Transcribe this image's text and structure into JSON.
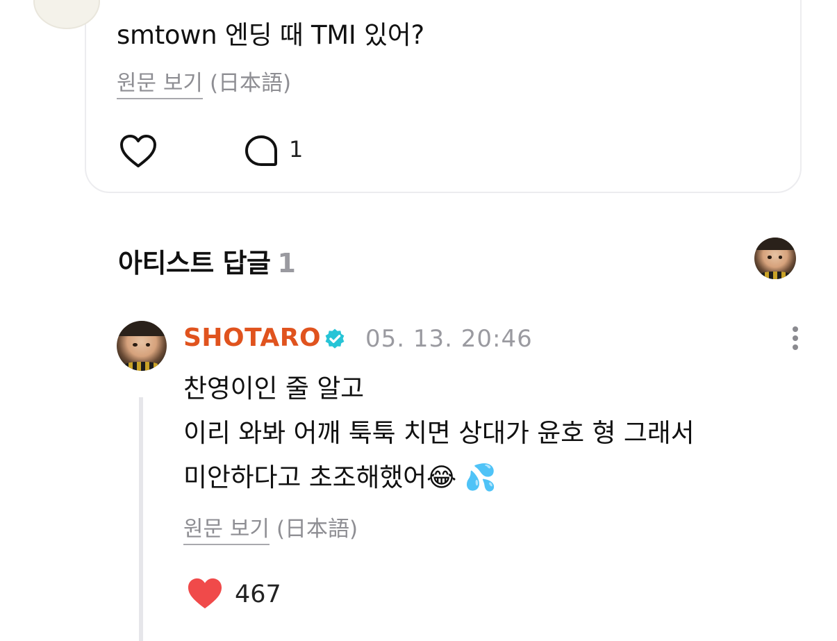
{
  "post": {
    "text": "smtown 엔딩 때 TMI 있어?",
    "view_original_label": "원문 보기",
    "original_language": "(日本語)",
    "comment_count": "1"
  },
  "artist_replies": {
    "title": "아티스트 답글",
    "count": "1"
  },
  "reply": {
    "author": "SHOTARO",
    "timestamp": "05. 13. 20:46",
    "lines": [
      "찬영이인 줄 알고",
      "이리 와봐 어깨 툭툭 치면 상대가 윤호 형 그래서",
      "미안하다고 초조해했어😂 💦"
    ],
    "view_original_label": "원문 보기",
    "original_language": "(日本語)",
    "like_count": "467"
  },
  "icons": {
    "heart_outline": "heart-icon",
    "comment": "comment-icon",
    "verified": "verified-badge-icon",
    "more": "more-vertical-icon",
    "heart_filled": "heart-filled-icon"
  },
  "colors": {
    "author_name": "#e0531e",
    "verified_badge": "#27c4d6",
    "liked_heart": "#f04a4a",
    "muted_text": "#8e8e93"
  }
}
